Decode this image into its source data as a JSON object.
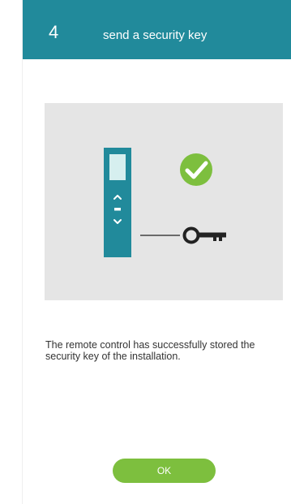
{
  "header": {
    "step_number": "4",
    "title": "send a security key"
  },
  "illustration": {
    "icons": [
      "remote-control-icon",
      "check-circle-icon",
      "key-icon"
    ],
    "colors": {
      "background": "#e5e5e5",
      "remote": "#218a9b",
      "check": "#7dbf3e",
      "key": "#222222"
    }
  },
  "message": {
    "text": "The remote control has successfully stored the security key of the installation."
  },
  "ok_button": {
    "label": "OK"
  },
  "colors": {
    "header_bg": "#218a9b",
    "button_bg": "#7dbf3e"
  }
}
